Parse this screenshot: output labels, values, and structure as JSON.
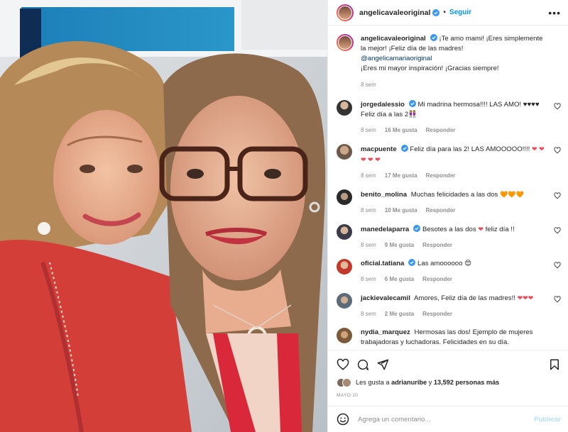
{
  "header": {
    "username": "angelicavaleoriginal",
    "separator": "•",
    "follow_label": "Seguir",
    "more_label": "•••"
  },
  "caption": {
    "username": "angelicavaleoriginal",
    "text_1": "¡Te amo mami! ¡Eres simplemente la mejor! ¡Feliz día de las madres!",
    "mention": "@angelicamariaoriginal",
    "text_2": "¡Eres mi mayor inspiración! ¡Gracias siempre!",
    "time": "8 sem"
  },
  "comments": [
    {
      "username": "jorgedalessio",
      "verified": true,
      "text": "Mi madrina hermosa!!!! LAS AMO! ♥♥♥♥ Feliz día a las 2👭",
      "time": "8 sem",
      "likes": "16 Me gusta",
      "reply": "Responder"
    },
    {
      "username": "macpuente",
      "verified": true,
      "text": "Feliz día para las 2! LAS AMOOOOO!!!!",
      "hearts": "❤ ❤ ❤ ❤ ❤",
      "time": "8 sem",
      "likes": "17 Me gusta",
      "reply": "Responder"
    },
    {
      "username": "benito_molina",
      "verified": false,
      "text": "Muchas felicidades a las dos",
      "hearts": "🧡🧡🧡",
      "time": "8 sem",
      "likes": "10 Me gusta",
      "reply": "Responder"
    },
    {
      "username": "manedelaparra",
      "verified": true,
      "text_1": "Besotes a las dos",
      "hearts": "❤",
      "text_2": "feliz día !!",
      "time": "8 sem",
      "likes": "9 Me gusta",
      "reply": "Responder"
    },
    {
      "username": "oficial.tatiana",
      "verified": true,
      "text": "Las amoooooo 😍",
      "time": "8 sem",
      "likes": "6 Me gusta",
      "reply": "Responder"
    },
    {
      "username": "jackievalecamil",
      "verified": false,
      "text": "Amores, Feliz día de las madres!!",
      "hearts": "❤❤❤",
      "time": "8 sem",
      "likes": "2 Me gusta",
      "reply": "Responder"
    },
    {
      "username": "nydia_marquez",
      "verified": false,
      "text": "Hermosas las dos! Ejemplo de mujeres trabajadoras y luchadoras. Felicidades en su día."
    }
  ],
  "likes": {
    "prefix": "Les gusta a",
    "user": "adrianuribe",
    "conj": "y",
    "count": "13,592 personas más"
  },
  "date": "MAYO 10",
  "add_comment": {
    "placeholder": "Agrega un comentario...",
    "publish_label": "Publicar"
  },
  "colors": {
    "accent": "#0095f6",
    "verified": "#3897f0",
    "like_red": "#ed4956",
    "muted": "#8e8e8e"
  },
  "icons": [
    "emoji-icon",
    "heart-icon",
    "comment-icon",
    "share-icon",
    "bookmark-icon",
    "more-icon",
    "verified-icon"
  ]
}
